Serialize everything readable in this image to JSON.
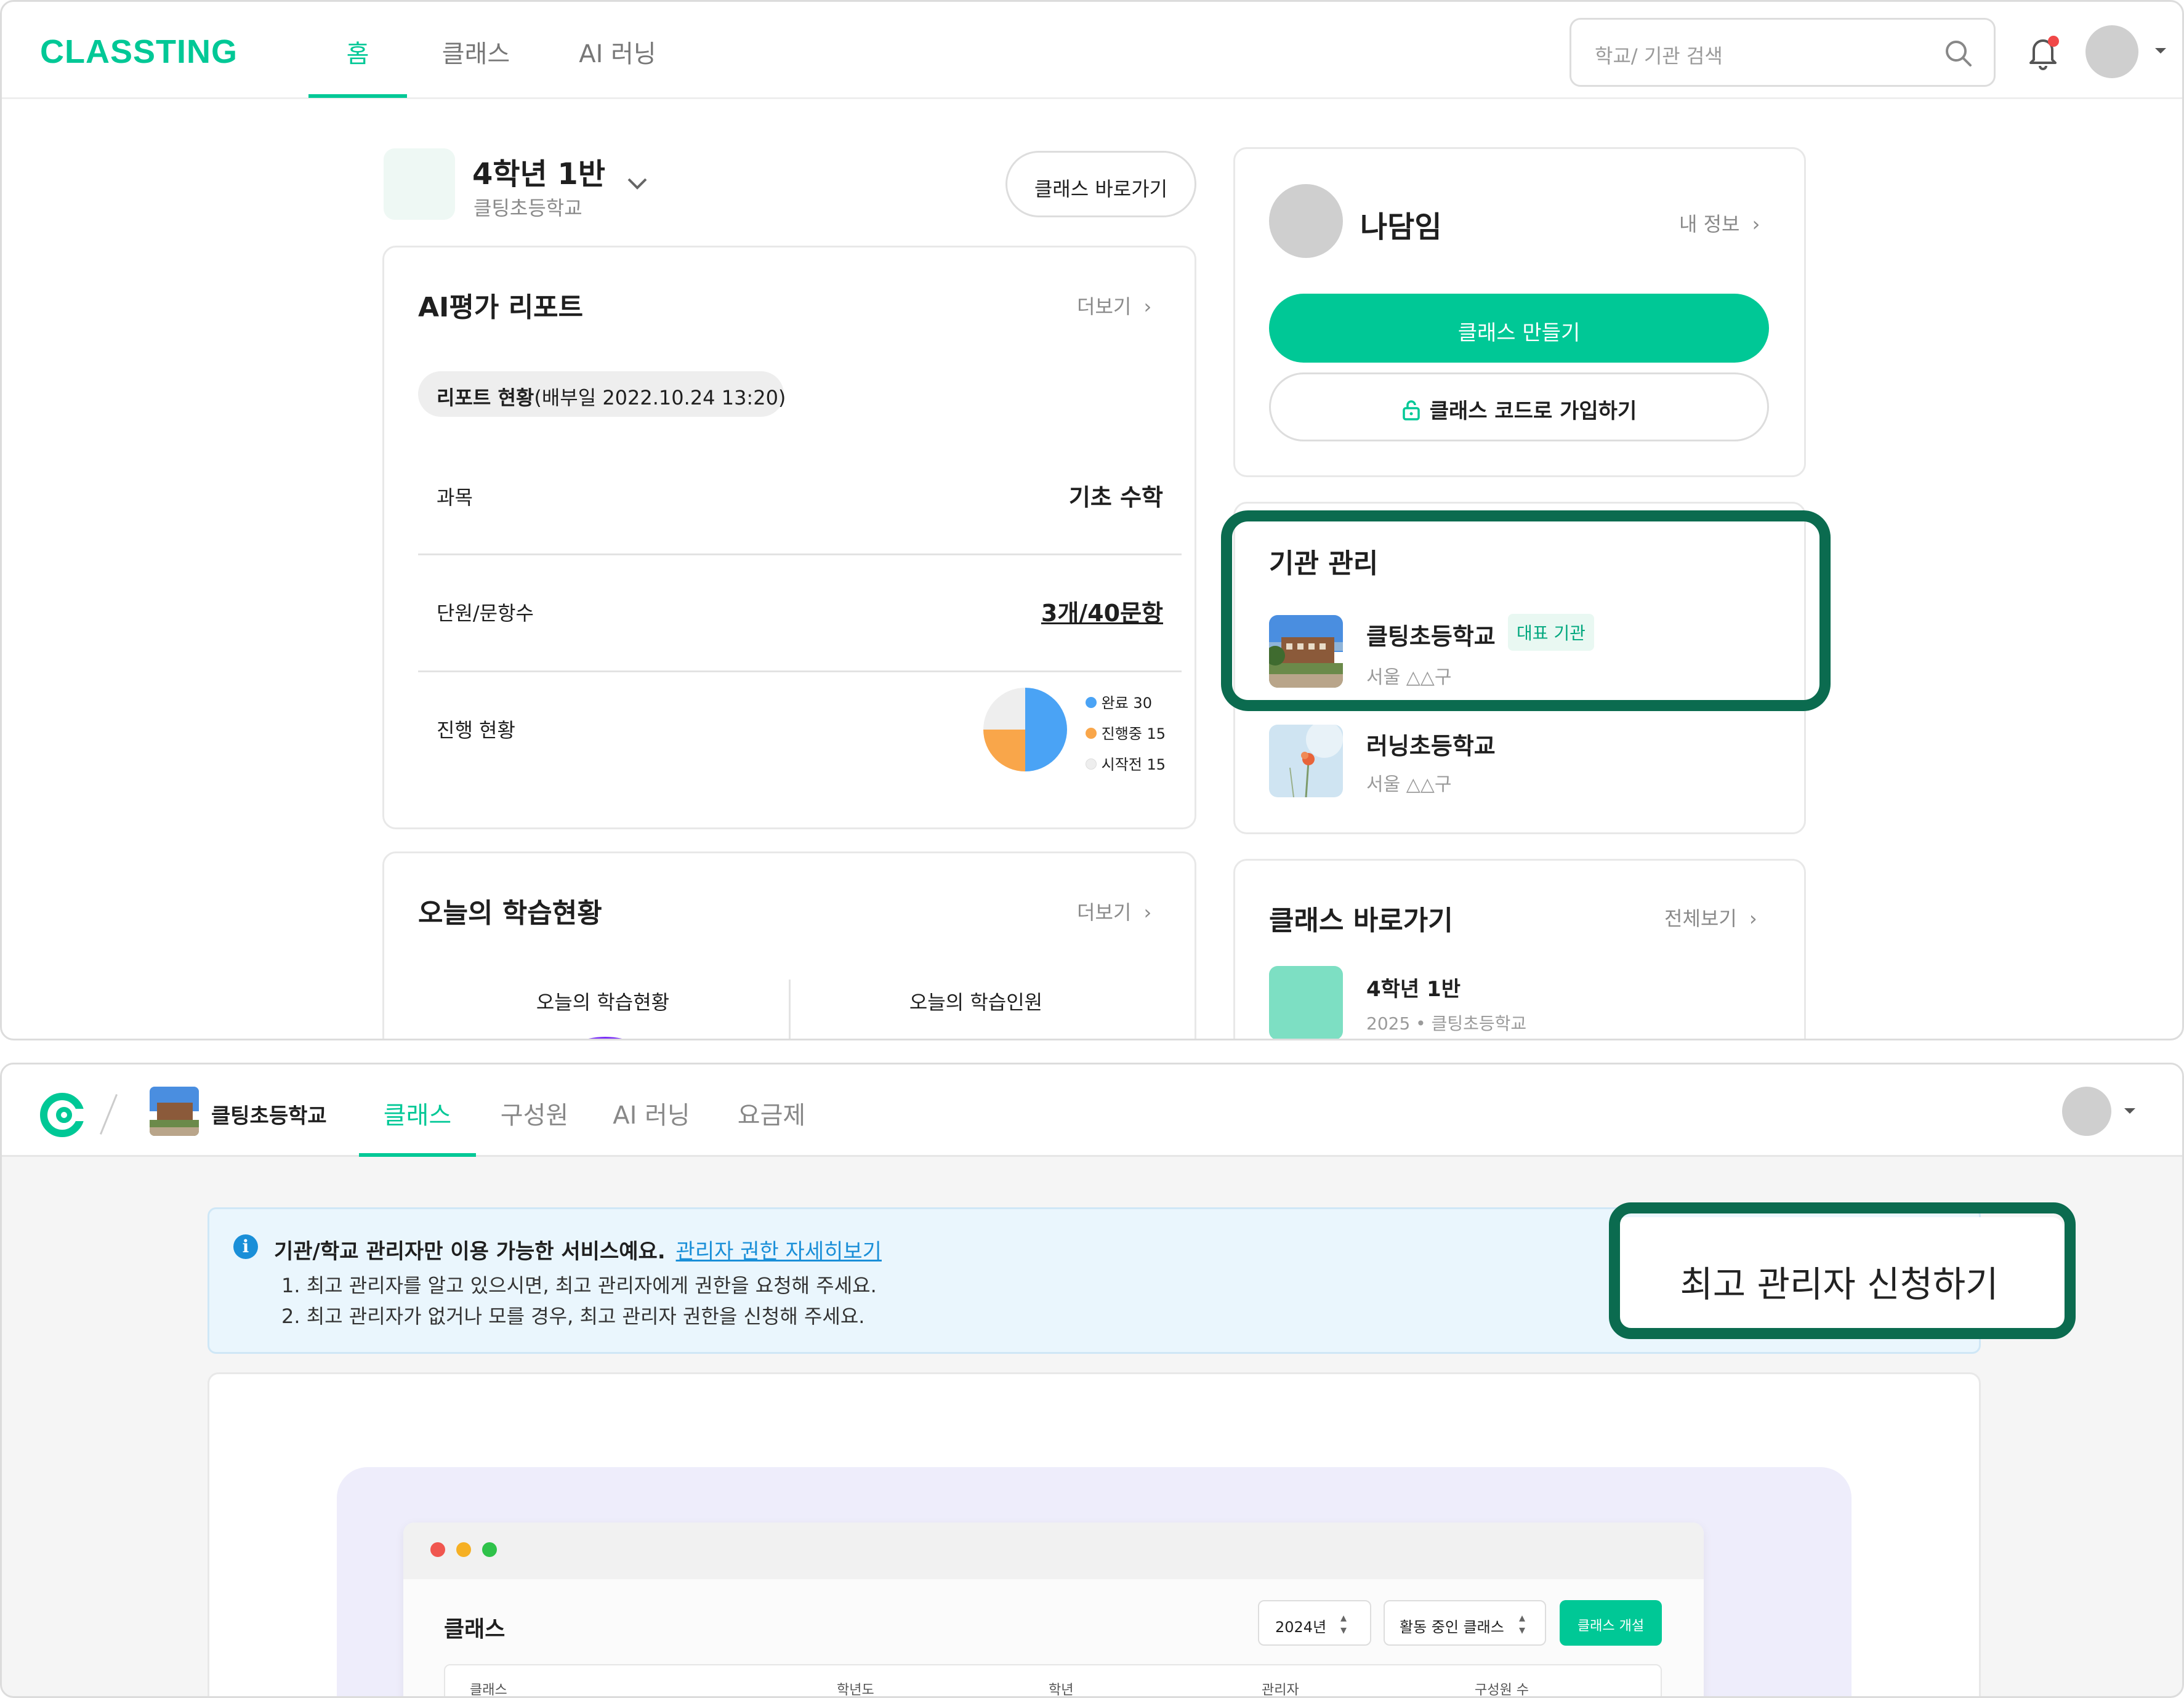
{
  "top": {
    "logo": "CLASSTING",
    "nav": [
      "홈",
      "클래스",
      "AI 러닝"
    ],
    "search_placeholder": "학교/ 기관 검색",
    "class_name": "4학년 1반",
    "school_name": "클팅초등학교",
    "class_shortcut_button": "클래스 바로가기",
    "report": {
      "title": "AI평가 리포트",
      "more": "더보기",
      "status_bold": "리포트 현황",
      "status_date": "(배부일 2022.10.24 13:20)",
      "subject_label": "과목",
      "subject_value": "기초 수학",
      "unit_label": "단원/문항수",
      "unit_value": "3개/40문항",
      "progress_label": "진행 현황",
      "legend": [
        {
          "label": "완료 30",
          "color": "#4aa3f5"
        },
        {
          "label": "진행중 15",
          "color": "#f9a64a"
        },
        {
          "label": "시작전 15",
          "color": "#eeeeee"
        }
      ]
    },
    "progress_chart": {
      "type": "pie",
      "categories": [
        "완료",
        "진행중",
        "시작전"
      ],
      "values": [
        30,
        15,
        15
      ],
      "colors": [
        "#4aa3f5",
        "#f9a64a",
        "#eeeeee"
      ]
    },
    "today": {
      "title": "오늘의 학습현황",
      "more": "더보기",
      "col1": "오늘의 학습현황",
      "col2": "오늘의 학습인원"
    },
    "profile": {
      "name": "나담임",
      "my_info": "내 정보",
      "create_class": "클래스 만들기",
      "join_code": "클래스 코드로 가입하기"
    },
    "institution": {
      "title": "기관 관리",
      "items": [
        {
          "name": "클팅초등학교",
          "badge": "대표 기관",
          "location": "서울 △△구"
        },
        {
          "name": "러닝초등학교",
          "badge": "",
          "location": "서울 △△구"
        }
      ]
    },
    "shortcut": {
      "title": "클래스 바로가기",
      "view_all": "전체보기",
      "class_name": "4학년 1반",
      "class_meta": "2025 • 클팅초등학교"
    }
  },
  "bottom": {
    "school_name": "클팅초등학교",
    "nav": [
      "클래스",
      "구성원",
      "AI 러닝",
      "요금제"
    ],
    "info": {
      "text": "기관/학교 관리자만 이용 가능한 서비스예요.",
      "link": "관리자 권한 자세히보기",
      "line1": "1. 최고 관리자를 알고 있으시면, 최고 관리자에게 권한을 요청해 주세요.",
      "line2": "2. 최고 관리자가 없거나 모를 경우, 최고 관리자 권한을 신청해 주세요."
    },
    "request_button": "최고 관리자 신청하기",
    "preview": {
      "title": "클래스",
      "year_select": "2024년",
      "status_select": "활동 중인 클래스",
      "create_button": "클래스 개설",
      "columns": [
        "클래스",
        "학년도",
        "학년",
        "관리자",
        "구성원 수"
      ]
    }
  },
  "colors": {
    "brand": "#00c896",
    "highlight": "#0b6b4f",
    "info_bg": "#eaf6fd",
    "link": "#1a8fd8"
  }
}
